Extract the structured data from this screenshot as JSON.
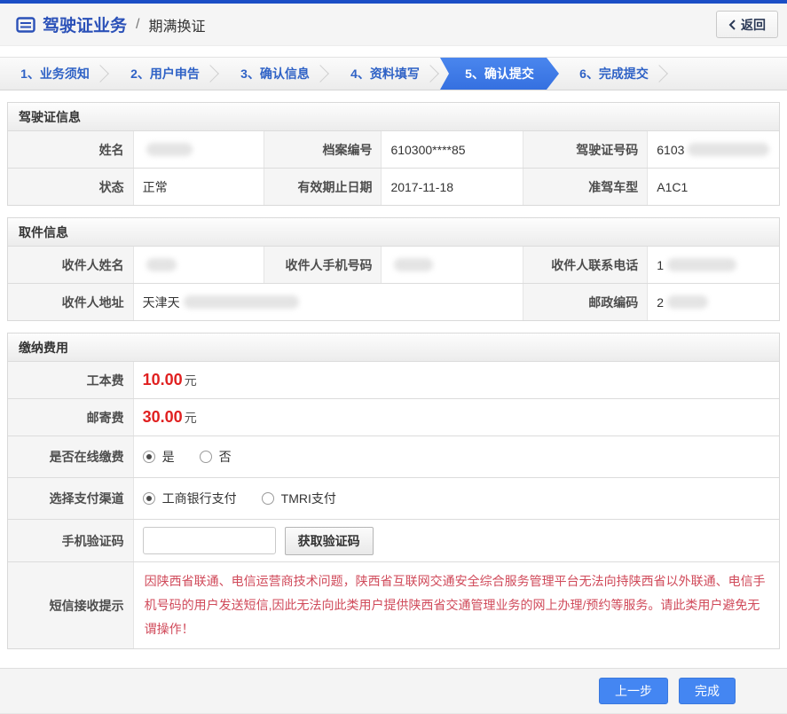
{
  "page": {
    "title": "驾驶证业务",
    "crumb_sep": "/",
    "subtitle": "期满换证",
    "back_label": "返回"
  },
  "steps": [
    {
      "label": "1、业务须知",
      "active": false
    },
    {
      "label": "2、用户申告",
      "active": false
    },
    {
      "label": "3、确认信息",
      "active": false
    },
    {
      "label": "4、资料填写",
      "active": false
    },
    {
      "label": "5、确认提交",
      "active": true
    },
    {
      "label": "6、完成提交",
      "active": false
    }
  ],
  "license": {
    "title": "驾驶证信息",
    "name_label": "姓名",
    "name_value": "",
    "file_no_label": "档案编号",
    "file_no_value": "610300****85",
    "license_no_label": "驾驶证号码",
    "license_no_value": "6103",
    "status_label": "状态",
    "status_value": "正常",
    "expiry_label": "有效期止日期",
    "expiry_value": "2017-11-18",
    "vehicle_class_label": "准驾车型",
    "vehicle_class_value": "A1C1"
  },
  "pickup": {
    "title": "取件信息",
    "recipient_name_label": "收件人姓名",
    "recipient_name_value": "",
    "recipient_mobile_label": "收件人手机号码",
    "recipient_mobile_value": "",
    "recipient_phone_label": "收件人联系电话",
    "recipient_phone_value": "1",
    "address_label": "收件人地址",
    "address_value": "天津天",
    "zip_label": "邮政编码",
    "zip_value": "2"
  },
  "fees": {
    "title": "缴纳费用",
    "cost_label": "工本费",
    "cost_amount": "10.00",
    "cost_unit": "元",
    "postage_label": "邮寄费",
    "postage_amount": "30.00",
    "postage_unit": "元",
    "online_label": "是否在线缴费",
    "online_options": [
      {
        "label": "是",
        "selected": true
      },
      {
        "label": "否",
        "selected": false
      }
    ],
    "channel_label": "选择支付渠道",
    "channel_options": [
      {
        "label": "工商银行支付",
        "selected": true
      },
      {
        "label": "TMRI支付",
        "selected": false
      }
    ],
    "captcha_label": "手机验证码",
    "captcha_value": "",
    "captcha_button": "获取验证码",
    "sms_label": "短信接收提示",
    "sms_note": "因陕西省联通、电信运营商技术问题，陕西省互联网交通安全综合服务管理平台无法向持陕西省以外联通、电信手机号码的用户发送短信,因此无法向此类用户提供陕西省交通管理业务的网上办理/预约等服务。请此类用户避免无谓操作！"
  },
  "footer": {
    "prev_label": "上一步",
    "finish_label": "完成"
  },
  "colors": {
    "top_bar": "#1b4ec6",
    "title_blue": "#2b51b8",
    "step_text_blue": "#2f62c6",
    "step_active_bg": "#3b79e8",
    "price_red": "#e02020",
    "note_red": "#d04a5a",
    "button_blue": "#4486f2"
  }
}
